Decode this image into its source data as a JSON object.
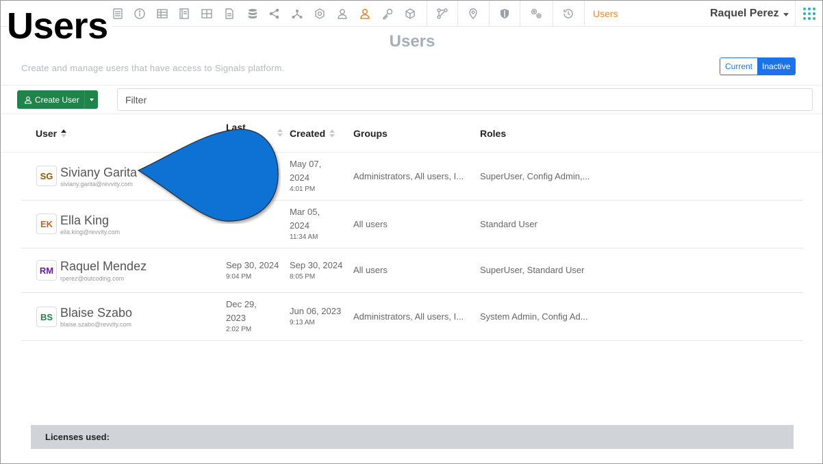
{
  "overlay_title": "Users",
  "toolbar": {
    "icons": [
      "calculator-icon",
      "info-icon",
      "table-icon",
      "notebook-icon",
      "grid-icon",
      "document-icon",
      "database-icon",
      "share-icon",
      "network-icon",
      "settings-badge-icon",
      "user-outline-icon",
      "user-icon",
      "key-icon",
      "cube-icon",
      "workflow-icon",
      "location-icon",
      "shield-icon",
      "gears-icon",
      "history-icon"
    ],
    "active_label": "Users",
    "current_user": "Raquel Perez"
  },
  "page": {
    "heading": "Users",
    "subtitle": "Create and manage users that have access to Signals platform.",
    "toggle": {
      "current": "Current",
      "inactive": "Inactive"
    }
  },
  "actions": {
    "create_user": "Create User",
    "filter_placeholder": "Filter"
  },
  "table": {
    "headers": {
      "user": "User",
      "last": "Last",
      "created": "Created",
      "groups": "Groups",
      "roles": "Roles"
    },
    "rows": [
      {
        "initials": "SG",
        "initials_color": "#8a5a00",
        "name": "Siviany Garita",
        "email": "siviany.garita@revvity.com",
        "last_date": "",
        "last_time": "",
        "created_date_1": "May 07,",
        "created_date_2": "2024",
        "created_time": "4:01 PM",
        "groups": "Administrators, All users, I...",
        "roles": "SuperUser, Config Admin,..."
      },
      {
        "initials": "EK",
        "initials_color": "#b8672a",
        "name": "Ella King",
        "email": "ella.king@revvity.com",
        "last_date": "",
        "last_time": "",
        "created_date_1": "Mar 05,",
        "created_date_2": "2024",
        "created_time": "11:34 AM",
        "groups": "All users",
        "roles": "Standard User"
      },
      {
        "initials": "RM",
        "initials_color": "#6a1b9a",
        "name": "Raquel Mendez",
        "email": "rperez@outcoding.com",
        "last_date": "Sep 30, 2024",
        "last_time": "9:04 PM",
        "created_date_1": "Sep 30, 2024",
        "created_date_2": "",
        "created_time": "8:05 PM",
        "groups": "All users",
        "roles": "SuperUser, Standard User"
      },
      {
        "initials": "BS",
        "initials_color": "#1e8449",
        "name": "Blaise Szabo",
        "email": "blaise.szabo@revvity.com",
        "last_date_1": "Dec 29,",
        "last_date_2": "2023",
        "last_time": "2:02 PM",
        "created_date_1": "Jun 06, 2023",
        "created_date_2": "",
        "created_time": "9:13 AM",
        "groups": "Administrators, All users, I...",
        "roles": "System Admin, Config Ad..."
      }
    ]
  },
  "footer": {
    "licenses_label": "Licenses used:"
  },
  "colors": {
    "accent_orange": "#e8892b",
    "primary_blue": "#1a73e8",
    "create_green": "#1e8449",
    "drop_blue": "#0a72d4"
  }
}
